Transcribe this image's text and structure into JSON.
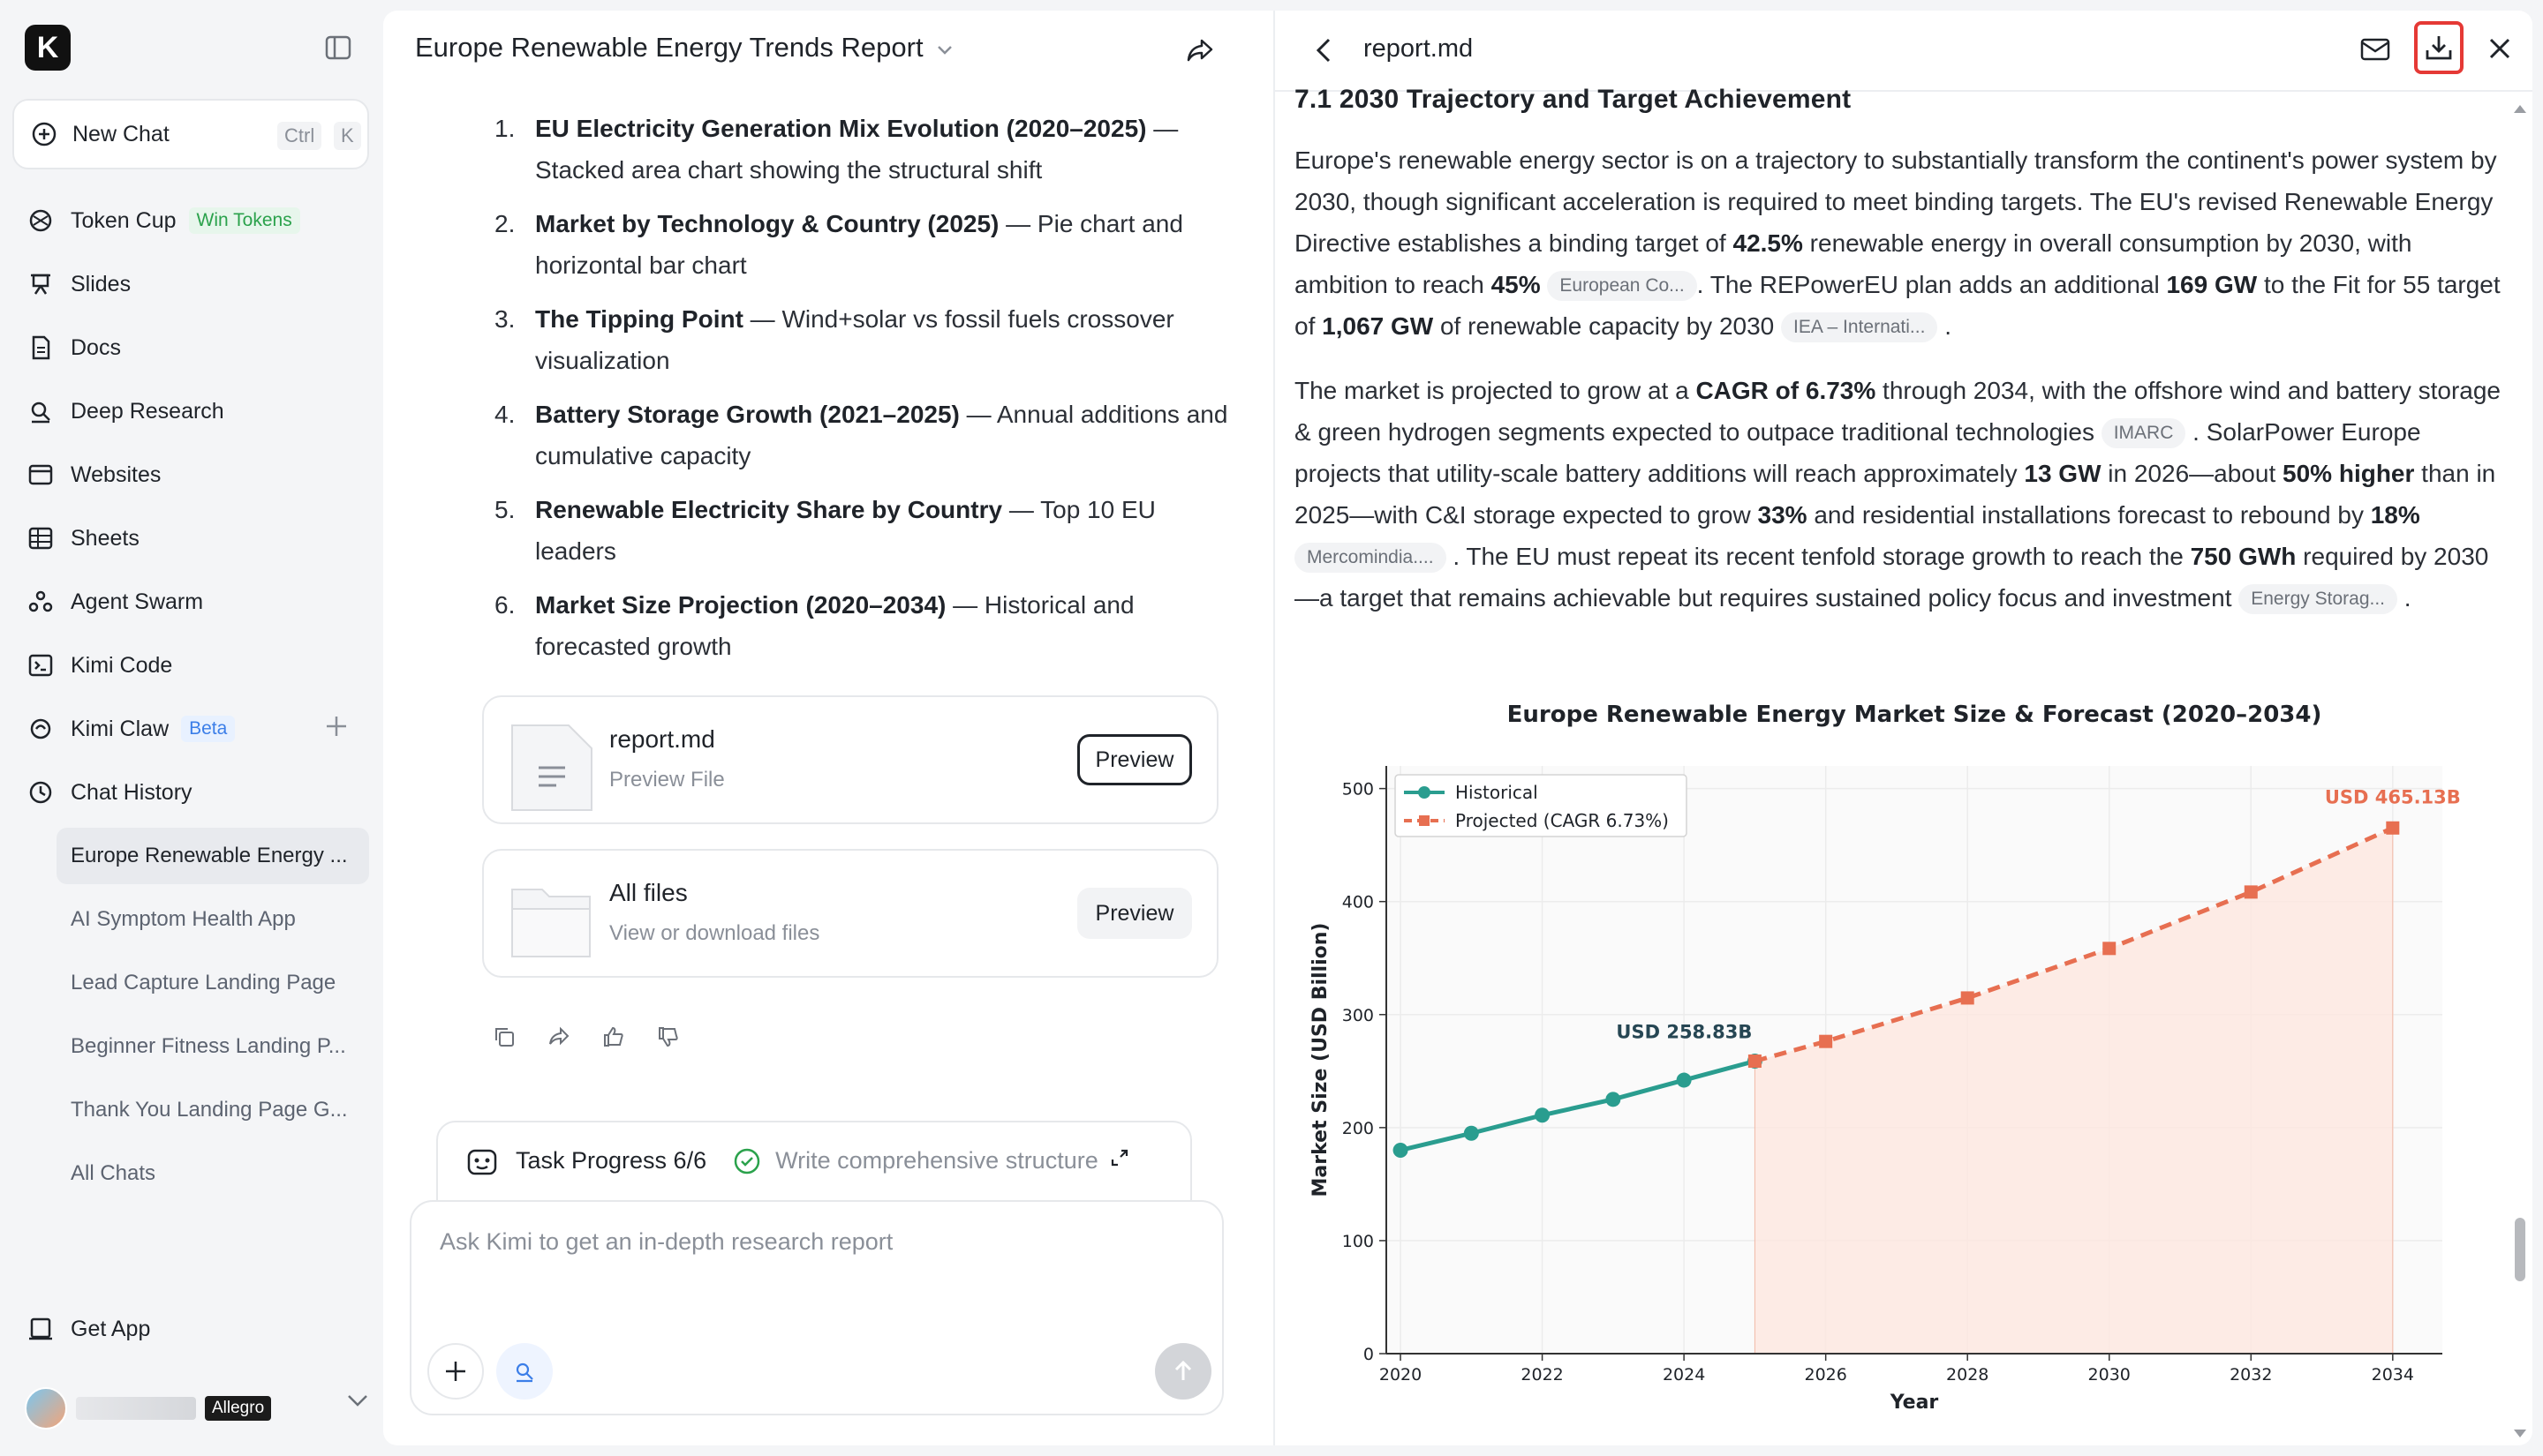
{
  "sidebar": {
    "logo_letter": "K",
    "new_chat": {
      "label": "New Chat",
      "shortcut_ctrl": "Ctrl",
      "shortcut_key": "K"
    },
    "nav": [
      {
        "label": "Token Cup",
        "badge": "Win Tokens",
        "icon": "trophy-icon"
      },
      {
        "label": "Slides",
        "icon": "slides-icon"
      },
      {
        "label": "Docs",
        "icon": "docs-icon"
      },
      {
        "label": "Deep Research",
        "icon": "deep-research-icon"
      },
      {
        "label": "Websites",
        "icon": "websites-icon"
      },
      {
        "label": "Sheets",
        "icon": "sheets-icon"
      },
      {
        "label": "Agent Swarm",
        "icon": "agent-swarm-icon"
      },
      {
        "label": "Kimi Code",
        "icon": "terminal-icon"
      },
      {
        "label": "Kimi Claw",
        "badge": "Beta",
        "icon": "claw-icon"
      },
      {
        "label": "Chat History",
        "icon": "clock-icon"
      }
    ],
    "history": [
      "Europe Renewable Energy ...",
      "AI Symptom Health App",
      "Lead Capture Landing Page",
      "Beginner Fitness Landing P...",
      "Thank You Landing Page G...",
      "All Chats"
    ],
    "get_app": "Get App",
    "user_plan": "Allegro"
  },
  "chat": {
    "title": "Europe Renewable Energy Trends Report",
    "list": [
      {
        "num": "1.",
        "bold": "EU Electricity Generation Mix Evolution (2020–2025)",
        "rest": " — Stacked area chart showing the structural shift"
      },
      {
        "num": "2.",
        "bold": "Market by Technology & Country (2025)",
        "rest": " — Pie chart and horizontal bar chart"
      },
      {
        "num": "3.",
        "bold": "The Tipping Point",
        "rest": " — Wind+solar vs fossil fuels crossover visualization"
      },
      {
        "num": "4.",
        "bold": "Battery Storage Growth (2021–2025)",
        "rest": " — Annual additions and cumulative capacity"
      },
      {
        "num": "5.",
        "bold": "Renewable Electricity Share by Country",
        "rest": " — Top 10 EU leaders"
      },
      {
        "num": "6.",
        "bold": "Market Size Projection (2020–2034)",
        "rest": " — Historical and forecasted growth"
      }
    ],
    "files": [
      {
        "name": "report.md",
        "sub": "Preview File",
        "button": "Preview"
      },
      {
        "name": "All files",
        "sub": "View or download files",
        "button": "Preview"
      }
    ],
    "task": {
      "label": "Task Progress 6/6",
      "step": "Write comprehensive structure"
    },
    "input_placeholder": "Ask Kimi to get an in-depth research report"
  },
  "preview": {
    "filename": "report.md",
    "heading": "7.1 2030 Trajectory and Target Achievement",
    "p1": {
      "t1": "Europe's renewable energy sector is on a trajectory to substantially transform the continent's power system by 2030, though significant acceleration is required to meet binding targets. The EU's revised Renewable Energy Directive establishes a binding target of ",
      "b1": "42.5%",
      "t2": " renewable energy in overall consumption by 2030, with ambition to reach ",
      "b2": "45%",
      "c1": "European Co...",
      "t3": ". The REPowerEU plan adds an additional ",
      "b3": "169 GW",
      "t4": " to the Fit for 55 target of ",
      "b4": "1,067 GW",
      "t5": " of renewable capacity by 2030 ",
      "c2": "IEA – Internati...",
      "t6": "."
    },
    "p2": {
      "t1": "The market is projected to grow at a ",
      "b1": "CAGR of 6.73%",
      "t2": " through 2034, with the offshore wind and battery storage & green hydrogen segments expected to outpace traditional technologies ",
      "c1": "IMARC",
      "t3": ". SolarPower Europe projects that utility-scale battery additions will reach approximately ",
      "b2": "13 GW",
      "t4": " in 2026—about ",
      "b3": "50% higher",
      "t5": " than in 2025—with C&I storage expected to grow ",
      "b4": "33%",
      "t6": " and residential installations forecast to rebound by ",
      "b5": "18%",
      "c2": "Mercomindia....",
      "t7": ". The EU must repeat its recent tenfold storage growth to reach the ",
      "b6": "750 GWh",
      "t8": " required by 2030—a target that remains achievable but requires sustained policy focus and investment ",
      "c3": "Energy Storag...",
      "t9": "."
    }
  },
  "chart_data": {
    "type": "line",
    "title": "Europe Renewable Energy Market Size & Forecast (2020–2034)",
    "xlabel": "Year",
    "ylabel": "Market Size (USD Billion)",
    "xlim": [
      2019.8,
      2034.7
    ],
    "ylim": [
      0,
      520
    ],
    "xticks": [
      2020,
      2022,
      2024,
      2026,
      2028,
      2030,
      2032,
      2034
    ],
    "yticks": [
      0,
      100,
      200,
      300,
      400,
      500
    ],
    "legend_position": "top-left",
    "grid": true,
    "series": [
      {
        "name": "Historical",
        "color": "#2a9d8f",
        "style": "solid",
        "marker": "circle",
        "x": [
          2020,
          2021,
          2022,
          2023,
          2024,
          2025
        ],
        "y": [
          180,
          195,
          211,
          225,
          242,
          258.83
        ]
      },
      {
        "name": "Projected (CAGR 6.73%)",
        "color": "#e76f51",
        "style": "dashed",
        "marker": "square",
        "x": [
          2025,
          2026,
          2028,
          2030,
          2032,
          2034
        ],
        "y": [
          258.83,
          276.25,
          314.71,
          358.52,
          408.44,
          465.13
        ]
      }
    ],
    "annotations": [
      {
        "text": "USD 258.83B",
        "x": 2025,
        "y": 258.83,
        "color": "#264653"
      },
      {
        "text": "USD 465.13B",
        "x": 2034,
        "y": 465.13,
        "color": "#e76f51"
      }
    ],
    "shaded_region": {
      "from": 2025,
      "to": 2034,
      "color": "#fde8e1"
    }
  }
}
